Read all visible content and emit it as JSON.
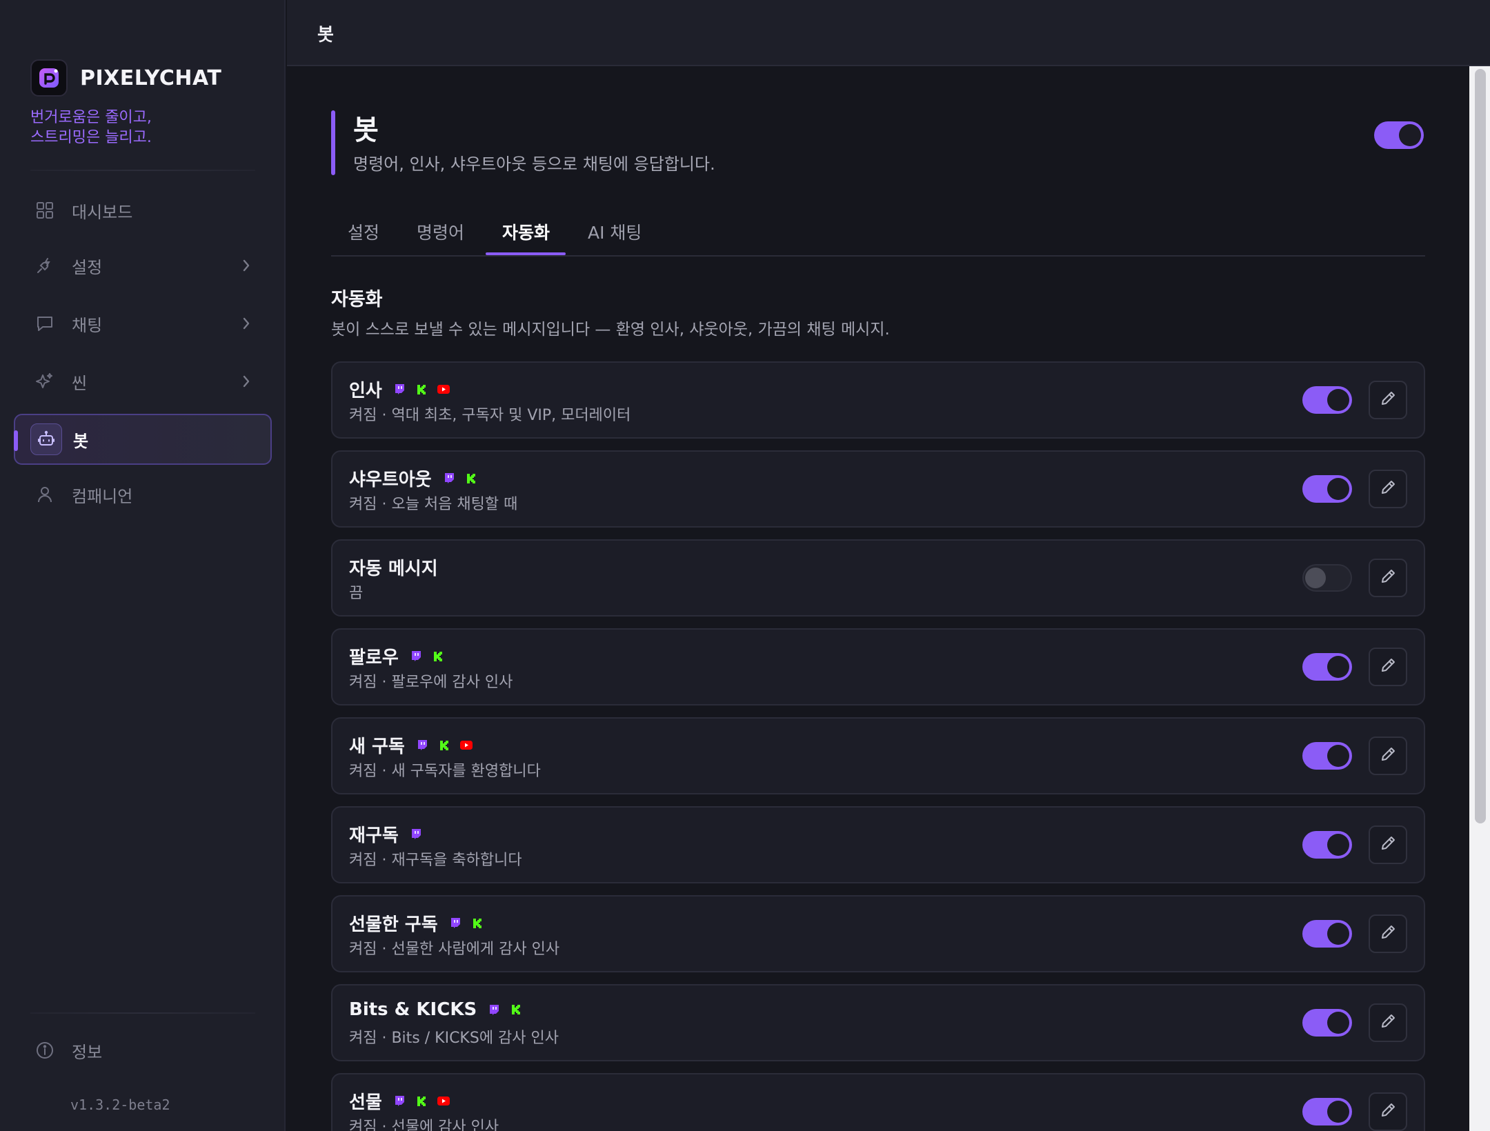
{
  "app": {
    "name": "PIXELYCHAT",
    "tagline_line1": "번거로움은 줄이고,",
    "tagline_line2": "스트리밍은 늘리고.",
    "version": "v1.3.2-beta2"
  },
  "sidebar": {
    "items": [
      {
        "label": "대시보드",
        "icon": "grid-icon"
      },
      {
        "label": "설정",
        "icon": "plug-icon"
      },
      {
        "label": "채팅",
        "icon": "chat-bubble-icon"
      },
      {
        "label": "씬",
        "icon": "sparkles-icon"
      },
      {
        "label": "봇",
        "icon": "bot-icon",
        "active": true
      },
      {
        "label": "컴패니언",
        "icon": "user-icon"
      }
    ],
    "footer_item": {
      "label": "정보",
      "icon": "info-icon"
    }
  },
  "topbar": {
    "title": "봇"
  },
  "page": {
    "title": "봇",
    "description": "명령어, 인사, 샤우트아웃 등으로 채팅에 응답합니다.",
    "enabled": true
  },
  "tabs": [
    {
      "label": "설정"
    },
    {
      "label": "명령어"
    },
    {
      "label": "자동화",
      "active": true
    },
    {
      "label": "AI 채팅"
    }
  ],
  "section": {
    "title": "자동화",
    "description": "봇이 스스로 보낼 수 있는 메시지입니다 — 환영 인사, 샤웃아웃, 가끔의 채팅 메시지."
  },
  "colors": {
    "accent": "#8b5cf6",
    "twitch": "#9146ff",
    "kick": "#53fc18",
    "youtube": "#ff0000"
  },
  "automations": [
    {
      "title": "인사",
      "subtitle": "켜짐 · 역대 최초, 구독자 및 VIP, 모더레이터",
      "enabled": true,
      "platforms": [
        "twitch",
        "kick",
        "youtube"
      ]
    },
    {
      "title": "샤우트아웃",
      "subtitle": "켜짐 · 오늘 처음 채팅할 때",
      "enabled": true,
      "platforms": [
        "twitch",
        "kick"
      ]
    },
    {
      "title": "자동 메시지",
      "subtitle": "끔",
      "enabled": false,
      "platforms": []
    },
    {
      "title": "팔로우",
      "subtitle": "켜짐 · 팔로우에 감사 인사",
      "enabled": true,
      "platforms": [
        "twitch",
        "kick"
      ]
    },
    {
      "title": "새 구독",
      "subtitle": "켜짐 · 새 구독자를 환영합니다",
      "enabled": true,
      "platforms": [
        "twitch",
        "kick",
        "youtube"
      ]
    },
    {
      "title": "재구독",
      "subtitle": "켜짐 · 재구독을 축하합니다",
      "enabled": true,
      "platforms": [
        "twitch"
      ]
    },
    {
      "title": "선물한 구독",
      "subtitle": "켜짐 · 선물한 사람에게 감사 인사",
      "enabled": true,
      "platforms": [
        "twitch",
        "kick"
      ]
    },
    {
      "title": "Bits & KICKS",
      "subtitle": "켜짐 · Bits / KICKS에 감사 인사",
      "enabled": true,
      "platforms": [
        "twitch",
        "kick"
      ]
    },
    {
      "title": "선물",
      "subtitle": "켜짐 · 선물에 감사 인사",
      "enabled": true,
      "platforms": [
        "twitch",
        "kick",
        "youtube"
      ]
    }
  ]
}
